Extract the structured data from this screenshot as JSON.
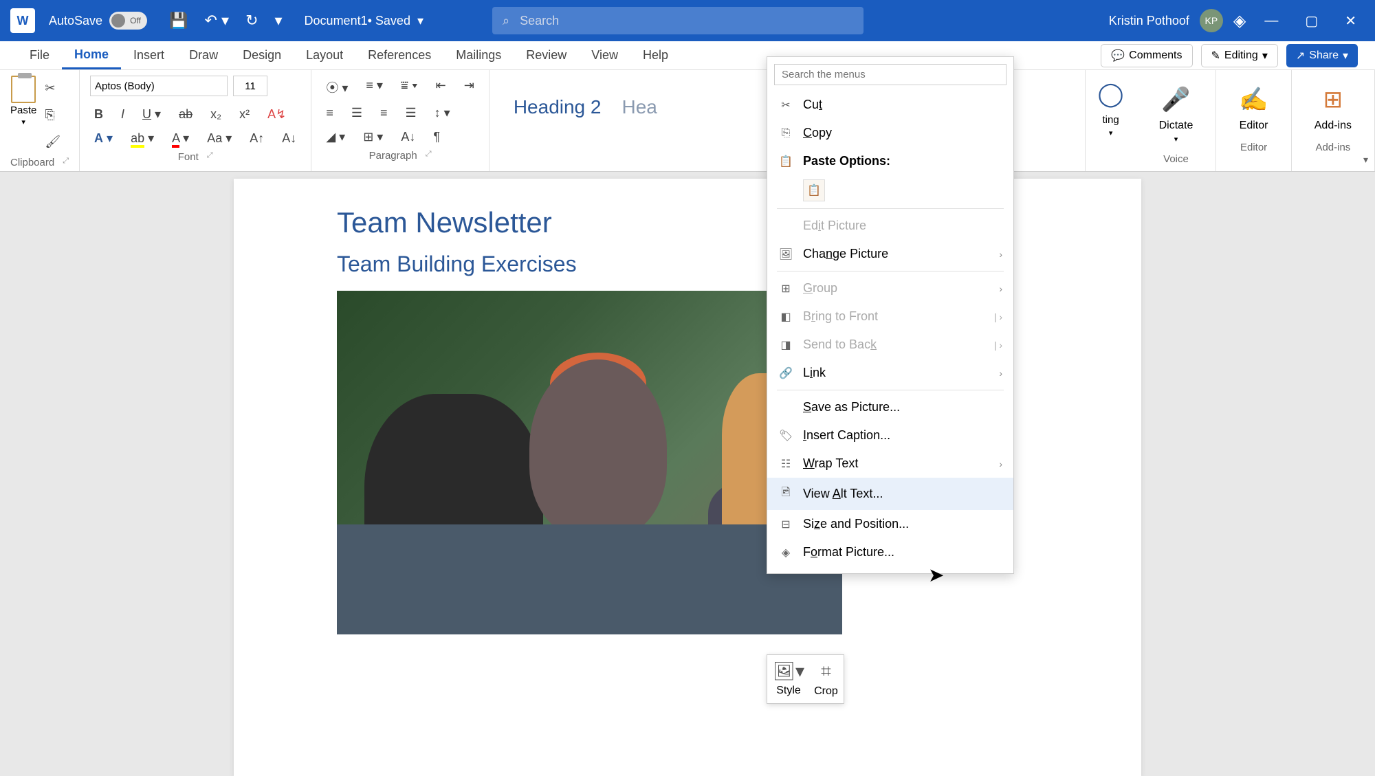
{
  "titleBar": {
    "autosaveLabel": "AutoSave",
    "autosaveState": "Off",
    "docTitle": "Document1",
    "docStatus": " • Saved",
    "searchPlaceholder": "Search",
    "userName": "Kristin Pothoof",
    "userInitials": "KP"
  },
  "tabs": {
    "file": "File",
    "home": "Home",
    "insert": "Insert",
    "draw": "Draw",
    "design": "Design",
    "layout": "Layout",
    "references": "References",
    "mailings": "Mailings",
    "review": "Review",
    "view": "View",
    "help": "Help",
    "comments": "Comments",
    "editing": "Editing",
    "share": "Share"
  },
  "ribbon": {
    "clipboard": {
      "paste": "Paste",
      "label": "Clipboard"
    },
    "font": {
      "name": "Aptos (Body)",
      "size": "11",
      "label": "Font"
    },
    "paragraph": {
      "label": "Paragraph"
    },
    "styles": {
      "heading2": "Heading 2",
      "headingPartial": "Hea"
    },
    "editingGroup": {
      "partial": "ting"
    },
    "voice": {
      "dictate": "Dictate",
      "label": "Voice"
    },
    "editor": {
      "editor": "Editor",
      "label": "Editor"
    },
    "addins": {
      "addins": "Add-ins",
      "label": "Add-ins"
    }
  },
  "document": {
    "title": "Team Newsletter",
    "subtitle": "Team Building Exercises"
  },
  "contextMenu": {
    "searchPlaceholder": "Search the menus",
    "cut": "Cut",
    "copy": "Copy",
    "pasteOptions": "Paste Options:",
    "editPicture": "Edit Picture",
    "changePicture": "Change Picture",
    "group": "Group",
    "bringToFront": "Bring to Front",
    "sendToBack": "Send to Back",
    "link": "Link",
    "saveAsPicture": "Save as Picture...",
    "insertCaption": "Insert Caption...",
    "wrapText": "Wrap Text",
    "viewAltText": "View Alt Text...",
    "sizeAndPosition": "Size and Position...",
    "formatPicture": "Format Picture..."
  },
  "miniToolbar": {
    "style": "Style",
    "crop": "Crop"
  }
}
